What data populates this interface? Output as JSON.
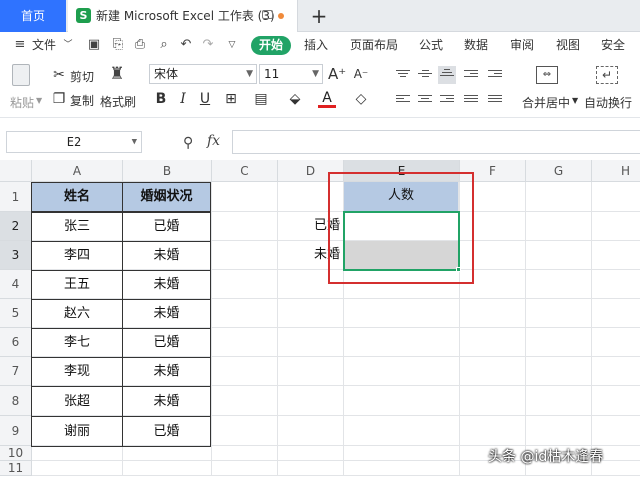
{
  "tabbar": {
    "home_label": "首页",
    "doc_logo": "S",
    "doc_title": "新建 Microsoft Excel 工作表 (3)",
    "add_label": "+"
  },
  "menubar": {
    "file_label": "文件",
    "items": [
      "开始",
      "插入",
      "页面布局",
      "公式",
      "数据",
      "审阅",
      "视图",
      "安全"
    ],
    "accent": "#21a366"
  },
  "ribbon": {
    "paste_label": "粘贴",
    "cut_label": "剪切",
    "copy_label": "复制",
    "format_painter_label": "格式刷",
    "font_name": "宋体",
    "font_size": "11",
    "merge_label": "合并居中",
    "wrap_label": "自动换行",
    "bold": "B",
    "italic": "I",
    "underline": "U",
    "font_color_letter": "A"
  },
  "formula_bar": {
    "name_box": "E2",
    "fx_label": "fx",
    "formula": ""
  },
  "grid": {
    "columns": [
      "A",
      "B",
      "C",
      "D",
      "E",
      "F",
      "G",
      "H"
    ],
    "selected_column": "E",
    "rows": [
      "1",
      "2",
      "3",
      "4",
      "5",
      "6",
      "7",
      "8",
      "9",
      "10",
      "11"
    ],
    "selected_rows": [
      "2",
      "3"
    ],
    "table_headers": [
      "姓名",
      "婚姻状况"
    ],
    "table_rows": [
      [
        "张三",
        "已婚"
      ],
      [
        "李四",
        "未婚"
      ],
      [
        "王五",
        "未婚"
      ],
      [
        "赵六",
        "未婚"
      ],
      [
        "李七",
        "已婚"
      ],
      [
        "李现",
        "未婚"
      ],
      [
        "张超",
        "未婚"
      ],
      [
        "谢丽",
        "已婚"
      ]
    ],
    "d_labels": [
      "已婚",
      "未婚"
    ],
    "e_header": "人数",
    "e_values": [
      "",
      ""
    ]
  },
  "watermark": "头条 @id枯木逢春",
  "colors": {
    "header_fill": "#b5c9e3",
    "selection": "#21a366",
    "highlight_box": "#d42f2f",
    "home_tab": "#2f73ff"
  }
}
